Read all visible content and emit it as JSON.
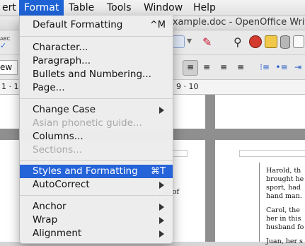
{
  "menubar": {
    "items": [
      "ert",
      "Format",
      "Table",
      "Tools",
      "Window",
      "Help"
    ],
    "active_index": 1
  },
  "window": {
    "title": "example.doc - OpenOffice Write"
  },
  "toolbar": {
    "style_box_fragment": "ew F",
    "spell_label": "ABC"
  },
  "ruler": {
    "left_ticks": "1 · 1 ·",
    "right_ticks": "· 9 · 10"
  },
  "document": {
    "left_fragments": [
      "n",
      "of",
      "ol of",
      "y."
    ],
    "right_lines": [
      "Harold, th",
      "brought he",
      "sport, had",
      "hand man.",
      "Carol, the",
      "her in this",
      "husband fo",
      "Juan, her s"
    ]
  },
  "format_menu": {
    "items": [
      {
        "label": "Default Formatting",
        "shortcut": "^M",
        "disabled": false,
        "submenu": false
      },
      {
        "label": "Character...",
        "disabled": false,
        "submenu": false
      },
      {
        "label": "Paragraph...",
        "disabled": false,
        "submenu": false
      },
      {
        "label": "Bullets and Numbering...",
        "disabled": false,
        "submenu": false
      },
      {
        "label": "Page...",
        "disabled": false,
        "submenu": false
      },
      {
        "label": "Change Case",
        "disabled": false,
        "submenu": true
      },
      {
        "label": "Asian phonetic guide...",
        "disabled": true,
        "submenu": false
      },
      {
        "label": "Columns...",
        "disabled": false,
        "submenu": false
      },
      {
        "label": "Sections...",
        "disabled": true,
        "submenu": false
      },
      {
        "label": "Styles and Formatting",
        "shortcut": "⌘T",
        "disabled": false,
        "submenu": false,
        "highlighted": true
      },
      {
        "label": "AutoCorrect",
        "disabled": false,
        "submenu": true
      },
      {
        "label": "Anchor",
        "disabled": false,
        "submenu": true
      },
      {
        "label": "Wrap",
        "disabled": false,
        "submenu": true
      },
      {
        "label": "Alignment",
        "disabled": false,
        "submenu": true
      }
    ]
  },
  "colors": {
    "menu_highlight": "#2563d8",
    "menubar_active": "#1e63d6",
    "disabled_text": "#a8a8a8"
  }
}
